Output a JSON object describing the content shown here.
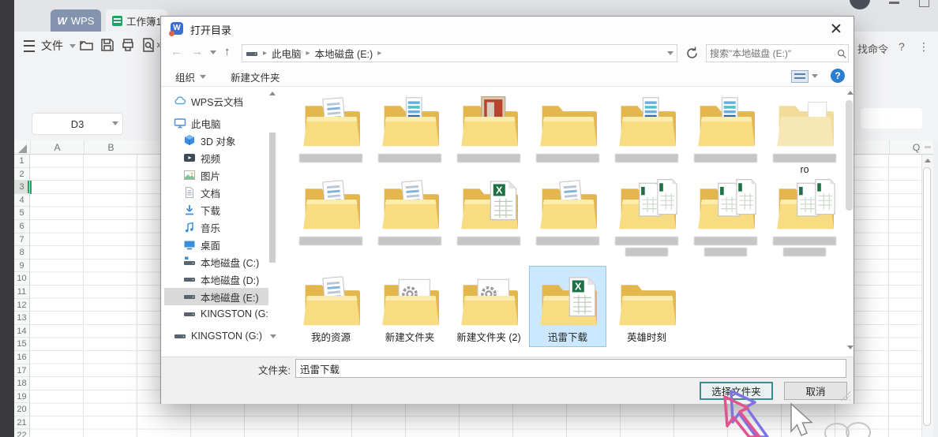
{
  "app": {
    "window_tabs": [
      {
        "label": "WPS"
      },
      {
        "label": "工作簿1"
      }
    ],
    "menu": {
      "file": "文件"
    },
    "right_menu": {
      "find_command": "找命令",
      "help": "?",
      "more": "⋮"
    },
    "name_box": "D3",
    "columns_left": [
      "A",
      "B"
    ],
    "column_right": "Q",
    "row_numbers": [
      "1",
      "2",
      "3",
      "4",
      "5",
      "6",
      "7",
      "8",
      "9",
      "10",
      "11",
      "12",
      "13",
      "14",
      "15",
      "16",
      "17",
      "18",
      "19",
      "20",
      "21",
      "22"
    ],
    "selected_row": "3"
  },
  "dialog": {
    "title": "打开目录",
    "nav": {
      "breadcrumb": [
        "此电脑",
        "本地磁盘 (E:)"
      ],
      "search_placeholder": "搜索\"本地磁盘 (E:)\""
    },
    "toolbar": {
      "organize": "组织",
      "new_folder": "新建文件夹"
    },
    "sidebar": {
      "items": [
        {
          "label": "WPS云文档",
          "icon": "cloud",
          "indent": 0
        },
        {
          "label": "此电脑",
          "icon": "computer",
          "indent": 0,
          "gap": true
        },
        {
          "label": "3D 对象",
          "icon": "cube",
          "indent": 1
        },
        {
          "label": "视频",
          "icon": "video",
          "indent": 1
        },
        {
          "label": "图片",
          "icon": "pictures",
          "indent": 1
        },
        {
          "label": "文档",
          "icon": "documents",
          "indent": 1
        },
        {
          "label": "下载",
          "icon": "download",
          "indent": 1
        },
        {
          "label": "音乐",
          "icon": "music",
          "indent": 1
        },
        {
          "label": "桌面",
          "icon": "desktop",
          "indent": 1
        },
        {
          "label": "本地磁盘 (C:)",
          "icon": "drive-windows",
          "indent": 1
        },
        {
          "label": "本地磁盘 (D:)",
          "icon": "drive",
          "indent": 1
        },
        {
          "label": "本地磁盘 (E:)",
          "icon": "drive",
          "indent": 1,
          "selected": true
        },
        {
          "label": "KINGSTON (G:",
          "icon": "drive",
          "indent": 1
        },
        {
          "label": "KINGSTON (G:)",
          "icon": "drive",
          "indent": 0,
          "gap": true,
          "chevron": true
        }
      ]
    },
    "files": {
      "rows": [
        {
          "items": [
            {
              "icon": "doc",
              "censored": true
            },
            {
              "icon": "book",
              "censored": true
            },
            {
              "icon": "photo",
              "censored": true
            },
            {
              "icon": "plain",
              "censored": true
            },
            {
              "icon": "book",
              "censored": true
            },
            {
              "icon": "book",
              "censored": true
            },
            {
              "icon": "light",
              "censored": true,
              "label": "ro"
            }
          ]
        },
        {
          "items": [
            {
              "icon": "doc",
              "censored": true
            },
            {
              "icon": "doc",
              "censored": true
            },
            {
              "icon": "excel",
              "censored": true
            },
            {
              "icon": "doc",
              "censored": true
            },
            {
              "icon": "sheets",
              "censored": true,
              "lines": 2
            },
            {
              "icon": "sheets",
              "censored": true,
              "lines": 2
            },
            {
              "icon": "sheets",
              "censored": true,
              "lines": 2
            }
          ]
        },
        {
          "items": [
            {
              "icon": "doc",
              "label": "我的资源"
            },
            {
              "icon": "gears",
              "label": "新建文件夹"
            },
            {
              "icon": "gears",
              "label": "新建文件夹 (2)"
            },
            {
              "icon": "excel",
              "label": "迅雷下载",
              "selected": true
            },
            {
              "icon": "plain",
              "label": "英雄时刻"
            }
          ]
        }
      ]
    },
    "footer": {
      "folder_label": "文件夹:",
      "folder_value": "迅雷下载",
      "select_button": "选择文件夹",
      "cancel_button": "取消"
    }
  },
  "colors": {
    "selection_fill": "#cce8ff",
    "selection_border": "#8fc9f2",
    "default_button_border": "#3c8f88",
    "folder_yellow": "#f8dc81",
    "excel_green": "#1e7145",
    "wps_tab_blue": "#8494ae",
    "help_blue": "#2a7ed2"
  },
  "annotations": {
    "hand_drawn_arrow": "points to 选择文件夹 button"
  }
}
